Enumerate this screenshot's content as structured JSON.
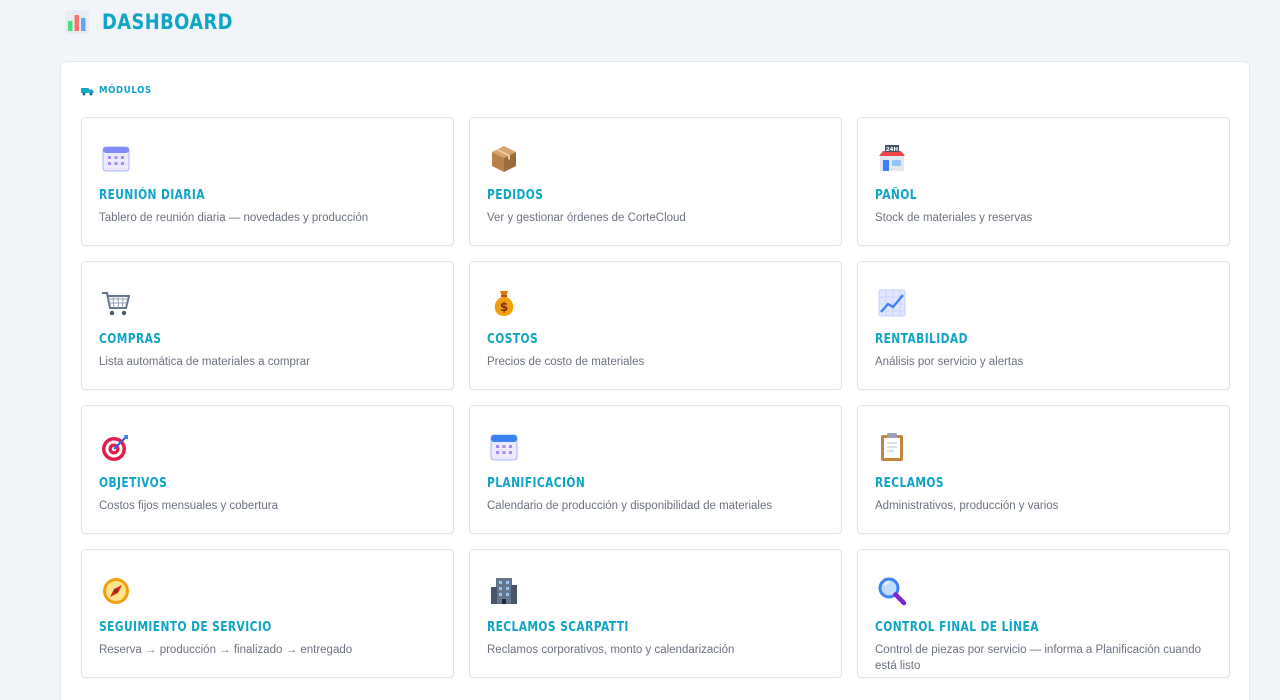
{
  "header": {
    "title": "DASHBOARD"
  },
  "section": {
    "label": "MÓDULOS"
  },
  "modules": [
    {
      "name": "REUNIÓN DIARIA",
      "desc": "Tablero de reunión diaria — novedades y producción",
      "icon": "calendar-grid-icon"
    },
    {
      "name": "PEDIDOS",
      "desc": "Ver y gestionar órdenes de CorteCloud",
      "icon": "package-icon"
    },
    {
      "name": "PAÑOL",
      "desc": "Stock de materiales y reservas",
      "icon": "store-24h-icon"
    },
    {
      "name": "COMPRAS",
      "desc": "Lista automática de materiales a comprar",
      "icon": "shopping-cart-icon"
    },
    {
      "name": "COSTOS",
      "desc": "Precios de costo de materiales",
      "icon": "money-bag-icon"
    },
    {
      "name": "RENTABILIDAD",
      "desc": "Análisis por servicio y alertas",
      "icon": "chart-increasing-icon"
    },
    {
      "name": "OBJETIVOS",
      "desc": "Costos fijos mensuales y cobertura",
      "icon": "target-icon"
    },
    {
      "name": "PLANIFICACIÓN",
      "desc": "Calendario de producción y disponibilidad de materiales",
      "icon": "calendar-icon"
    },
    {
      "name": "RECLAMOS",
      "desc": "Administrativos, producción y varios",
      "icon": "clipboard-icon"
    },
    {
      "name": "SEGUIMIENTO DE SERVICIO",
      "desc": "Reserva → producción → finalizado → entregado",
      "icon": "compass-icon"
    },
    {
      "name": "RECLAMOS SCARPATTI",
      "desc": "Reclamos corporativos, monto y calendarización",
      "icon": "office-building-icon"
    },
    {
      "name": "CONTROL FINAL DE LÍNEA",
      "desc": "Control de piezas por servicio — informa a Planificación cuando está listo",
      "icon": "magnifier-icon"
    }
  ]
}
